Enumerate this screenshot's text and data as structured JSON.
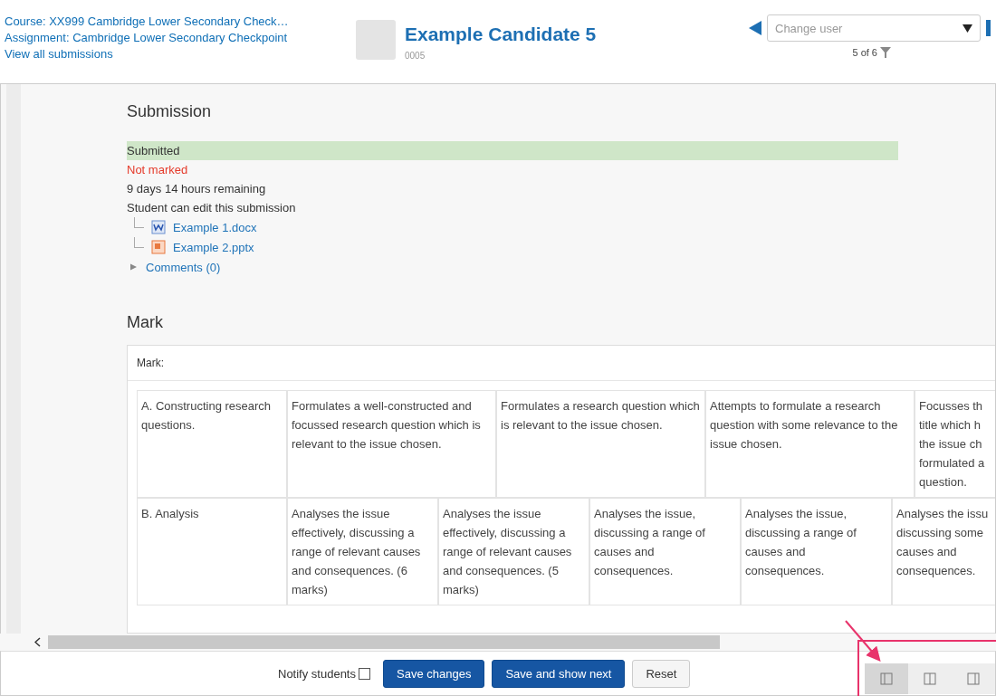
{
  "header": {
    "links": [
      "Course: XX999 Cambridge Lower Secondary Check…",
      "Assignment: Cambridge Lower Secondary Checkpoint",
      "View all submissions"
    ],
    "candidate": {
      "name": "Example Candidate 5",
      "id": "0005"
    },
    "user_select": {
      "placeholder": "Change user"
    },
    "position": "5 of 6"
  },
  "submission": {
    "heading": "Submission",
    "status": [
      {
        "text": "Submitted",
        "kind": "success"
      },
      {
        "text": "Not marked",
        "kind": "alert"
      },
      {
        "text": "9 days 14 hours remaining",
        "kind": "plain"
      },
      {
        "text": "Student can edit this submission",
        "kind": "plain"
      }
    ],
    "files": [
      {
        "name": "Example 1.docx",
        "kind": "word"
      },
      {
        "name": "Example 2.pptx",
        "kind": "slides"
      }
    ],
    "comments": {
      "label": "Comments (0)",
      "expanded": false
    }
  },
  "mark": {
    "heading": "Mark",
    "label": "Mark:",
    "rubric": [
      {
        "criterion": "A. Constructing research questions.",
        "levels": [
          "Formulates a well-constructed and focussed research question which is relevant to the issue chosen.",
          "Formulates a research question which is relevant to the issue chosen.",
          "Attempts to formulate a research question with some relevance to the issue chosen.",
          "Focusses th\ntitle which h\nthe issue ch\nformulated a\nquestion."
        ]
      },
      {
        "criterion": "B. Analysis",
        "levels": [
          "Analyses the issue effectively, discussing a range of relevant causes and consequences. (6 marks)",
          "Analyses the issue effectively, discussing a range of relevant causes and consequences. (5 marks)",
          "Analyses the issue, discussing a range of causes and consequences.",
          "Analyses the issue, discussing a range of causes and consequences.",
          "Analyses the issu\ndiscussing some\ncauses and\nconsequences."
        ]
      }
    ]
  },
  "footer": {
    "notify": {
      "label": "Notify students",
      "checked": false
    },
    "buttons": [
      {
        "label": "Save changes",
        "kind": "primary"
      },
      {
        "label": "Save and show next",
        "kind": "primary"
      },
      {
        "label": "Reset",
        "kind": "plain"
      }
    ],
    "layouts": [
      {
        "kind": "left",
        "selected": true
      },
      {
        "kind": "split",
        "selected": false
      },
      {
        "kind": "right",
        "selected": false
      }
    ]
  }
}
